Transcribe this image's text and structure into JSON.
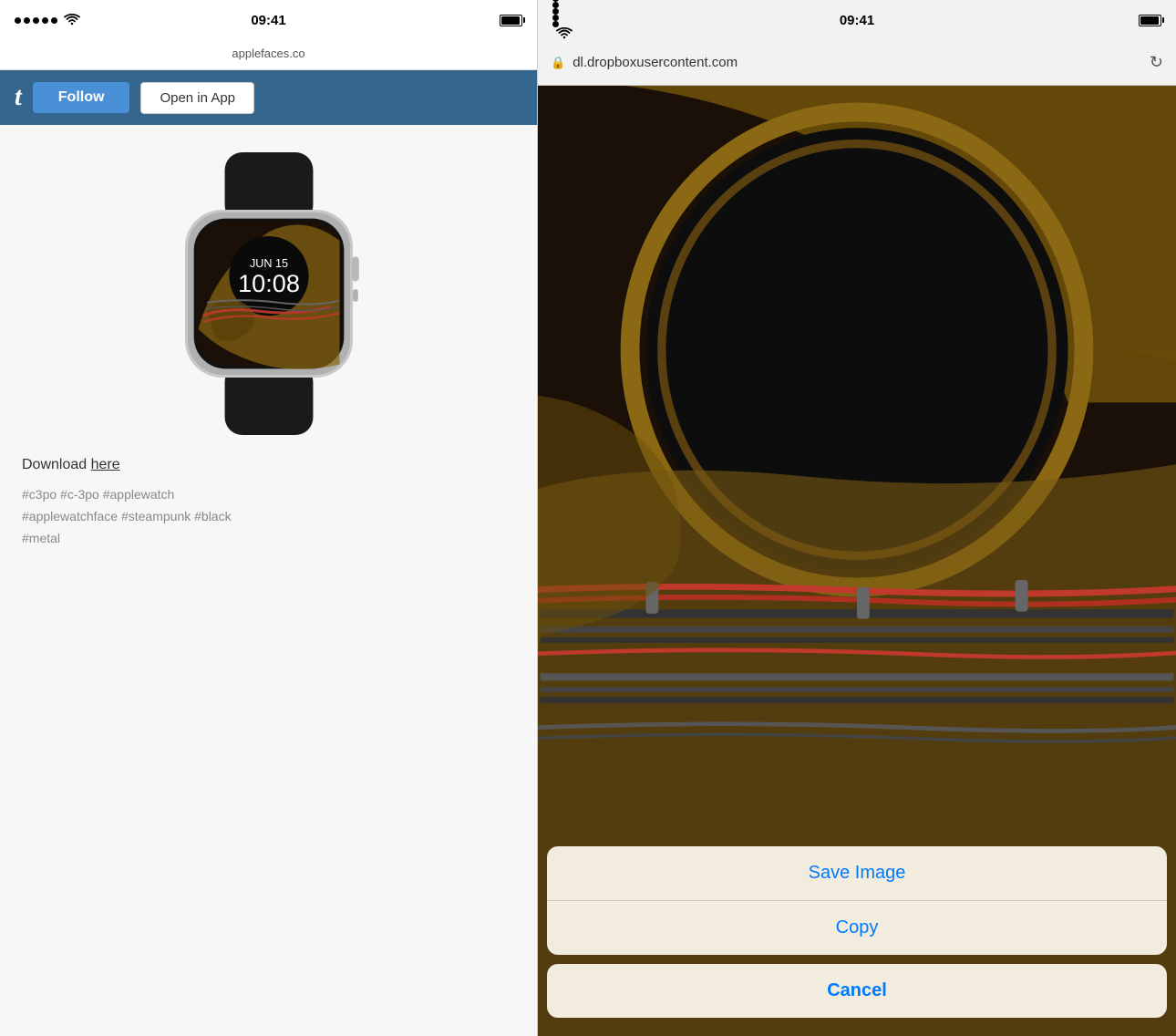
{
  "left": {
    "statusBar": {
      "time": "09:41",
      "url": "applefaces.co"
    },
    "nav": {
      "logo": "t",
      "followLabel": "Follow",
      "openInAppLabel": "Open in App"
    },
    "content": {
      "watchDate": "JUN 15",
      "watchTime": "10:08",
      "downloadLabel": "Download ",
      "downloadLinkText": "here",
      "hashtags": "#c3po  #c-3po  #applewatch\n#applewatchface  #steampunk  #black\n#metal"
    }
  },
  "right": {
    "statusBar": {
      "time": "09:41"
    },
    "browserBar": {
      "url": "dl.dropboxusercontent.com"
    },
    "contextMenu": {
      "saveImageLabel": "Save Image",
      "copyLabel": "Copy",
      "cancelLabel": "Cancel"
    }
  }
}
